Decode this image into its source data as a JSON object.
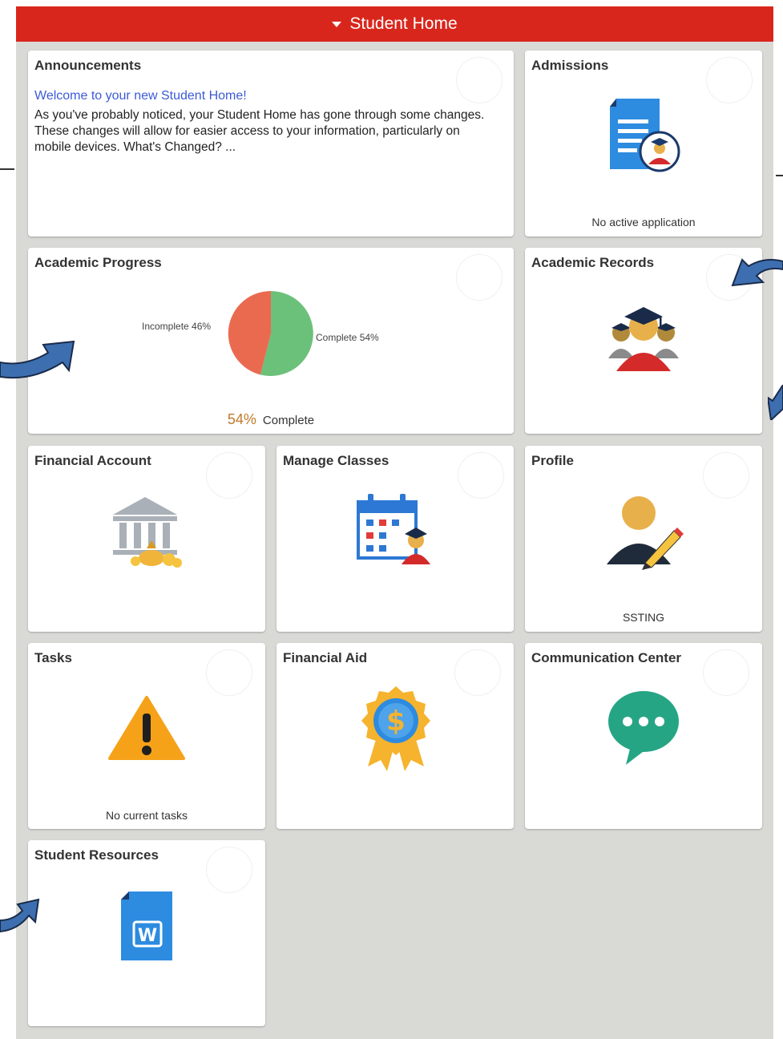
{
  "header": {
    "title": "Student Home"
  },
  "tiles": {
    "announcements": {
      "title": "Announcements",
      "link": "Welcome to your new Student Home!",
      "body": "As you've probably noticed, your Student Home has gone through some changes. These changes will allow for easier access to your information, particularly on mobile devices. What's Changed? ..."
    },
    "admissions": {
      "title": "Admissions",
      "footer": "No active application",
      "icon": "document-graduate-icon"
    },
    "academic_progress": {
      "title": "Academic Progress",
      "incomplete_label": "Incomplete 46%",
      "complete_label": "Complete 54%",
      "percent": "54%",
      "complete_word": "Complete"
    },
    "academic_records": {
      "title": "Academic Records",
      "icon": "graduates-group-icon"
    },
    "financial_account": {
      "title": "Financial Account",
      "icon": "bank-money-icon"
    },
    "manage_classes": {
      "title": "Manage Classes",
      "icon": "calendar-graduate-icon"
    },
    "profile": {
      "title": "Profile",
      "footer": "SSTING",
      "icon": "user-edit-icon"
    },
    "tasks": {
      "title": "Tasks",
      "footer": "No current tasks",
      "icon": "warning-icon"
    },
    "financial_aid": {
      "title": "Financial Aid",
      "icon": "dollar-award-icon"
    },
    "communication_center": {
      "title": "Communication Center",
      "icon": "chat-bubble-icon"
    },
    "student_resources": {
      "title": "Student Resources",
      "icon": "word-document-icon"
    }
  },
  "colors": {
    "header_red": "#d9261c",
    "panel_gray": "#d9d9d6",
    "link_blue": "#3b5bd6",
    "arrow_blue": "#3d6fb0",
    "pie_incomplete": "#ea6a50",
    "pie_complete": "#6cc17a",
    "percent_orange": "#c07a2a"
  }
}
